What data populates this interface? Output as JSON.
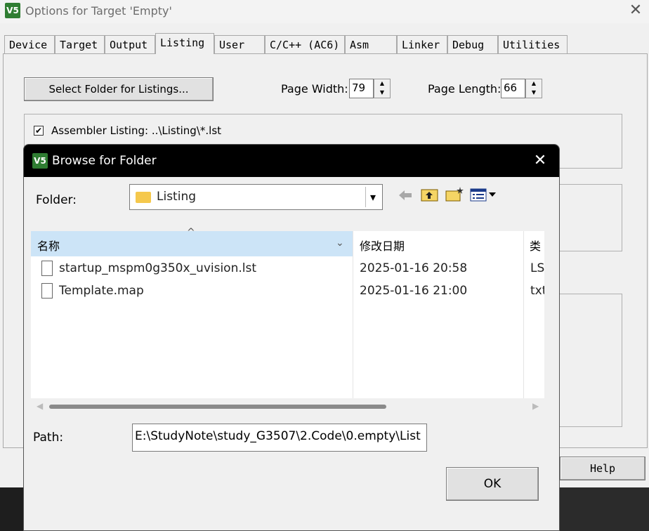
{
  "main_window": {
    "title": "Options for Target 'Empty'",
    "close_glyph": "✕",
    "logo_text": "V5",
    "tabs": [
      {
        "label": "Device"
      },
      {
        "label": "Target"
      },
      {
        "label": "Output"
      },
      {
        "label": "Listing"
      },
      {
        "label": "User"
      },
      {
        "label": "C/C++ (AC6)"
      },
      {
        "label": "Asm"
      },
      {
        "label": "Linker"
      },
      {
        "label": "Debug"
      },
      {
        "label": "Utilities"
      }
    ],
    "active_tab": "Listing",
    "select_folder_label": "Select Folder for Listings...",
    "page_width_label": "Page Width:",
    "page_width_value": "79",
    "page_length_label": "Page Length:",
    "page_length_value": "66",
    "assembler_listing_label": "Assembler Listing:  ..\\Listing\\*.lst",
    "assembler_listing_checked": true,
    "help_label": "Help"
  },
  "dialog": {
    "title": "Browse for Folder",
    "close_glyph": "✕",
    "logo_text": "V5",
    "folder_label": "Folder:",
    "folder_value": "Listing",
    "combo_arrow": "▾",
    "toolbar_icons": [
      "back-arrow-icon",
      "up-folder-icon",
      "new-folder-icon",
      "view-menu-icon"
    ],
    "columns": [
      "名称",
      "修改日期",
      "类"
    ],
    "files": [
      {
        "name": "startup_mspm0g350x_uvision.lst",
        "date": "2025-01-16 20:58",
        "type": "LS"
      },
      {
        "name": "Template.map",
        "date": "2025-01-16 21:00",
        "type": "txt"
      }
    ],
    "path_label": "Path:",
    "path_value": "E:\\StudyNote\\study_G3507\\2.Code\\0.empty\\List",
    "ok_label": "OK"
  },
  "colors": {
    "dialog_titlebar": "#000000",
    "list_header_highlight": "#cce4f7",
    "folder_yellow": "#f5c84c",
    "logo_green": "#2f7d32"
  }
}
